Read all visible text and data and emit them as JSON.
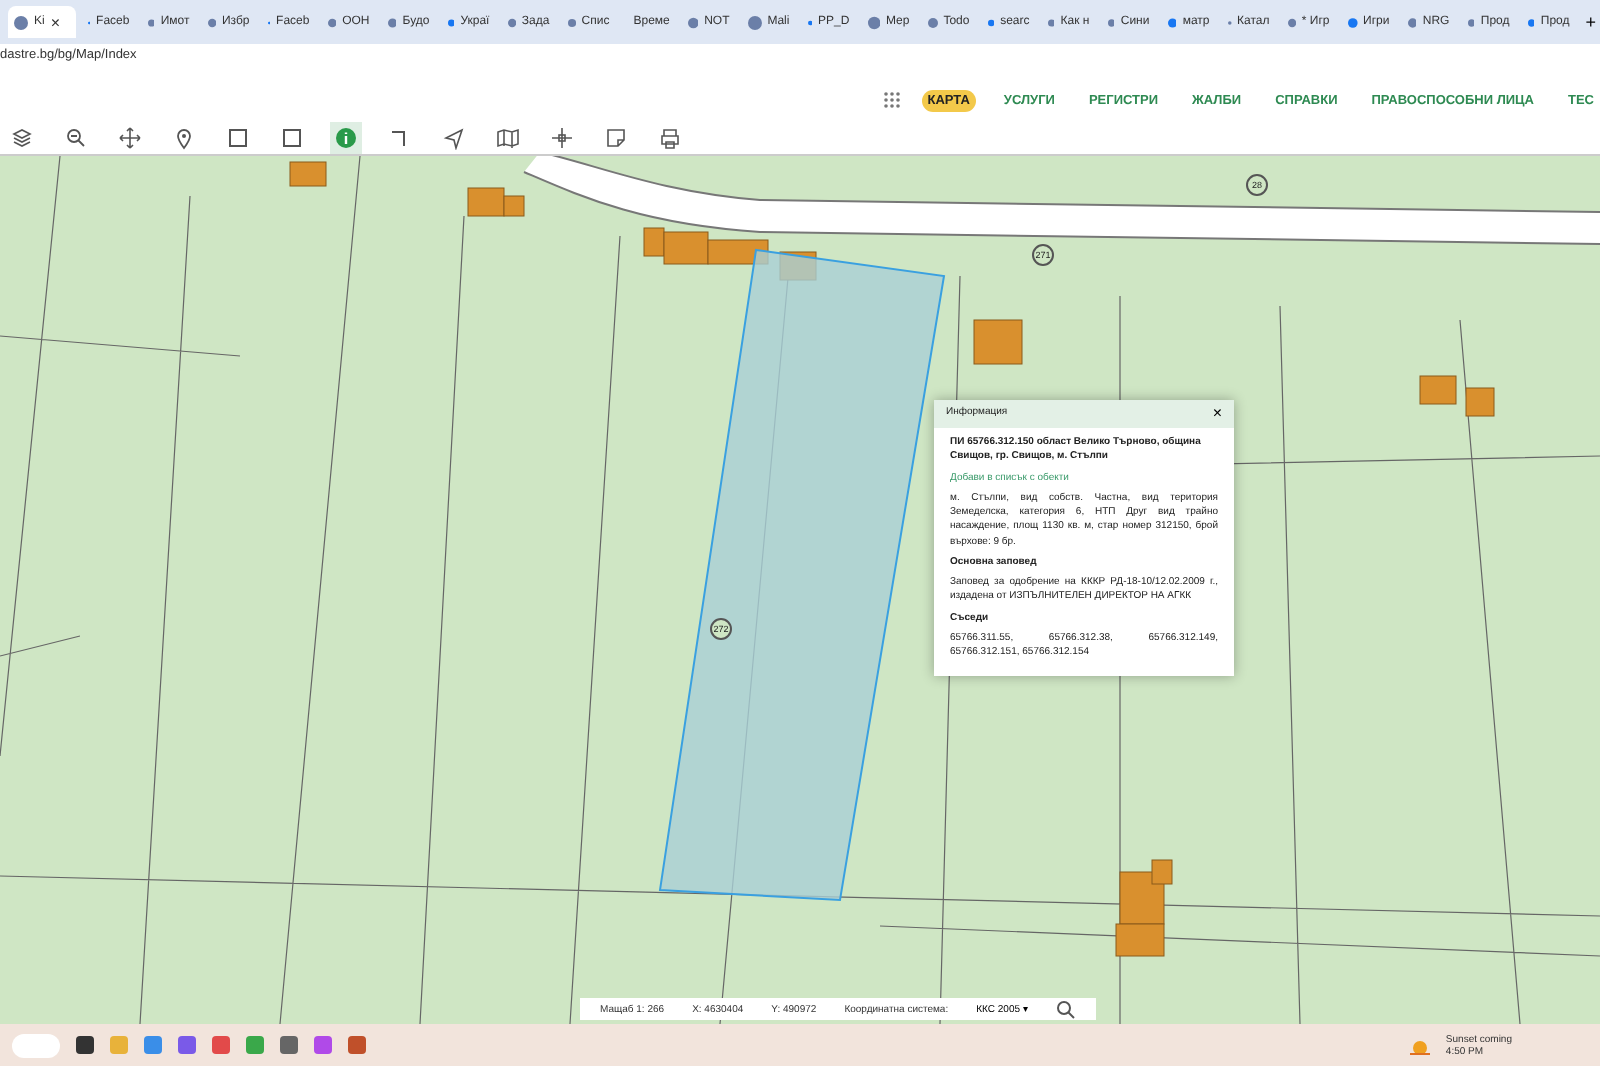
{
  "browser": {
    "tabs": [
      {
        "label": "Ki",
        "selected": true
      },
      {
        "label": "Faceb",
        "selected": false
      },
      {
        "label": "Имот",
        "selected": false
      },
      {
        "label": "Избр",
        "selected": false
      },
      {
        "label": "Faceb",
        "selected": false
      },
      {
        "label": "ООН",
        "selected": false
      },
      {
        "label": "Будо",
        "selected": false
      },
      {
        "label": "Украї",
        "selected": false
      },
      {
        "label": "Зада",
        "selected": false
      },
      {
        "label": "Спис",
        "selected": false
      },
      {
        "label": "Време",
        "selected": false
      },
      {
        "label": "NOT",
        "selected": false
      },
      {
        "label": "Mali",
        "selected": false
      },
      {
        "label": "PP_D",
        "selected": false
      },
      {
        "label": "Мер",
        "selected": false
      },
      {
        "label": "Todo",
        "selected": false
      },
      {
        "label": "searc",
        "selected": false
      },
      {
        "label": "Как н",
        "selected": false
      },
      {
        "label": "Сини",
        "selected": false
      },
      {
        "label": "матр",
        "selected": false
      },
      {
        "label": "Катал",
        "selected": false
      },
      {
        "label": "* Игр",
        "selected": false
      },
      {
        "label": "Игри",
        "selected": false
      },
      {
        "label": "NRG",
        "selected": false
      },
      {
        "label": "Прод",
        "selected": false
      },
      {
        "label": "Прод",
        "selected": false
      }
    ],
    "close_tab": "×",
    "new_tab": "+",
    "url": "dastre.bg/bg/Map/Index"
  },
  "site": {
    "nav": [
      {
        "label": "КАРТА",
        "selected": true
      },
      {
        "label": "УСЛУГИ",
        "selected": false
      },
      {
        "label": "РЕГИСТРИ",
        "selected": false
      },
      {
        "label": "ЖАЛБИ",
        "selected": false
      },
      {
        "label": "СПРАВКИ",
        "selected": false
      },
      {
        "label": "ПРАВОСПОСОБНИ ЛИЦА",
        "selected": false
      },
      {
        "label": "ТЕС",
        "selected": false
      }
    ],
    "tools": [
      {
        "kind": "layers",
        "selected": false
      },
      {
        "kind": "zoom",
        "selected": false
      },
      {
        "kind": "pan",
        "selected": false
      },
      {
        "kind": "pin",
        "selected": false
      },
      {
        "kind": "rect",
        "selected": false
      },
      {
        "kind": "rect",
        "selected": false
      },
      {
        "kind": "info",
        "selected": true
      },
      {
        "kind": "corner",
        "selected": false
      },
      {
        "kind": "arrow",
        "selected": false
      },
      {
        "kind": "map",
        "selected": false
      },
      {
        "kind": "move",
        "selected": false
      },
      {
        "kind": "note",
        "selected": false
      },
      {
        "kind": "print",
        "selected": false
      }
    ]
  },
  "map": {
    "labels": [
      "28",
      "271",
      "272"
    ],
    "popup": {
      "title": "Информация",
      "close": "×",
      "heading": "ПИ 65766.312.150 област Велико Търново, община Свищов, гр. Свищов, м. Стълпи",
      "link": "Добави в списък с обекти",
      "details": "м. Стълпи, вид собств. Частна, вид територия Земеделска, категория 6, НТП Друг вид трайно насаждение, площ 1130 кв. м, стар номер 312150, брой върхове: 9 бр.",
      "order_title": "Основна заповед",
      "order": "Заповед за одобрение на КККР РД-18-10/12.02.2009 г., издадена от ИЗПЪЛНИТЕЛЕН ДИРЕКТОР НА АГКК",
      "neighbors_title": "Съседи",
      "neighbors": "65766.311.55, 65766.312.38, 65766.312.149, 65766.312.151, 65766.312.154"
    },
    "status": {
      "scale": "Мащаб 1: 266",
      "x": "X: 4630404",
      "y": "Y: 490972",
      "crs_label": "Координатна система:",
      "crs": "ККС 2005",
      "caret": "▾"
    }
  },
  "taskbar": {
    "weather": "Sunset coming",
    "time": "4:50 PM"
  }
}
